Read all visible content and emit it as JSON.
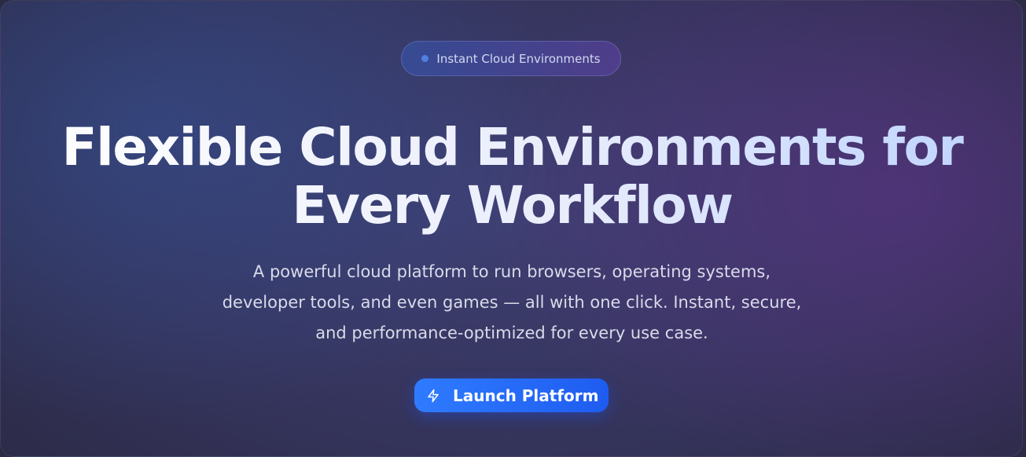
{
  "badge": {
    "label": "Instant Cloud Environments",
    "dot_color": "#4f7fe0"
  },
  "hero": {
    "headline_line1": "Flexible Cloud Environments for",
    "headline_line2": "Every Workflow",
    "subtitle_line1": "A powerful cloud platform to run browsers, operating systems,",
    "subtitle_line2": "developer tools, and even games — all with one click. Instant, secure,",
    "subtitle_line3": "and performance-optimized for every use case."
  },
  "cta": {
    "label": "Launch Platform",
    "icon": "lightning-bolt-icon",
    "color": "#2f7bff"
  }
}
